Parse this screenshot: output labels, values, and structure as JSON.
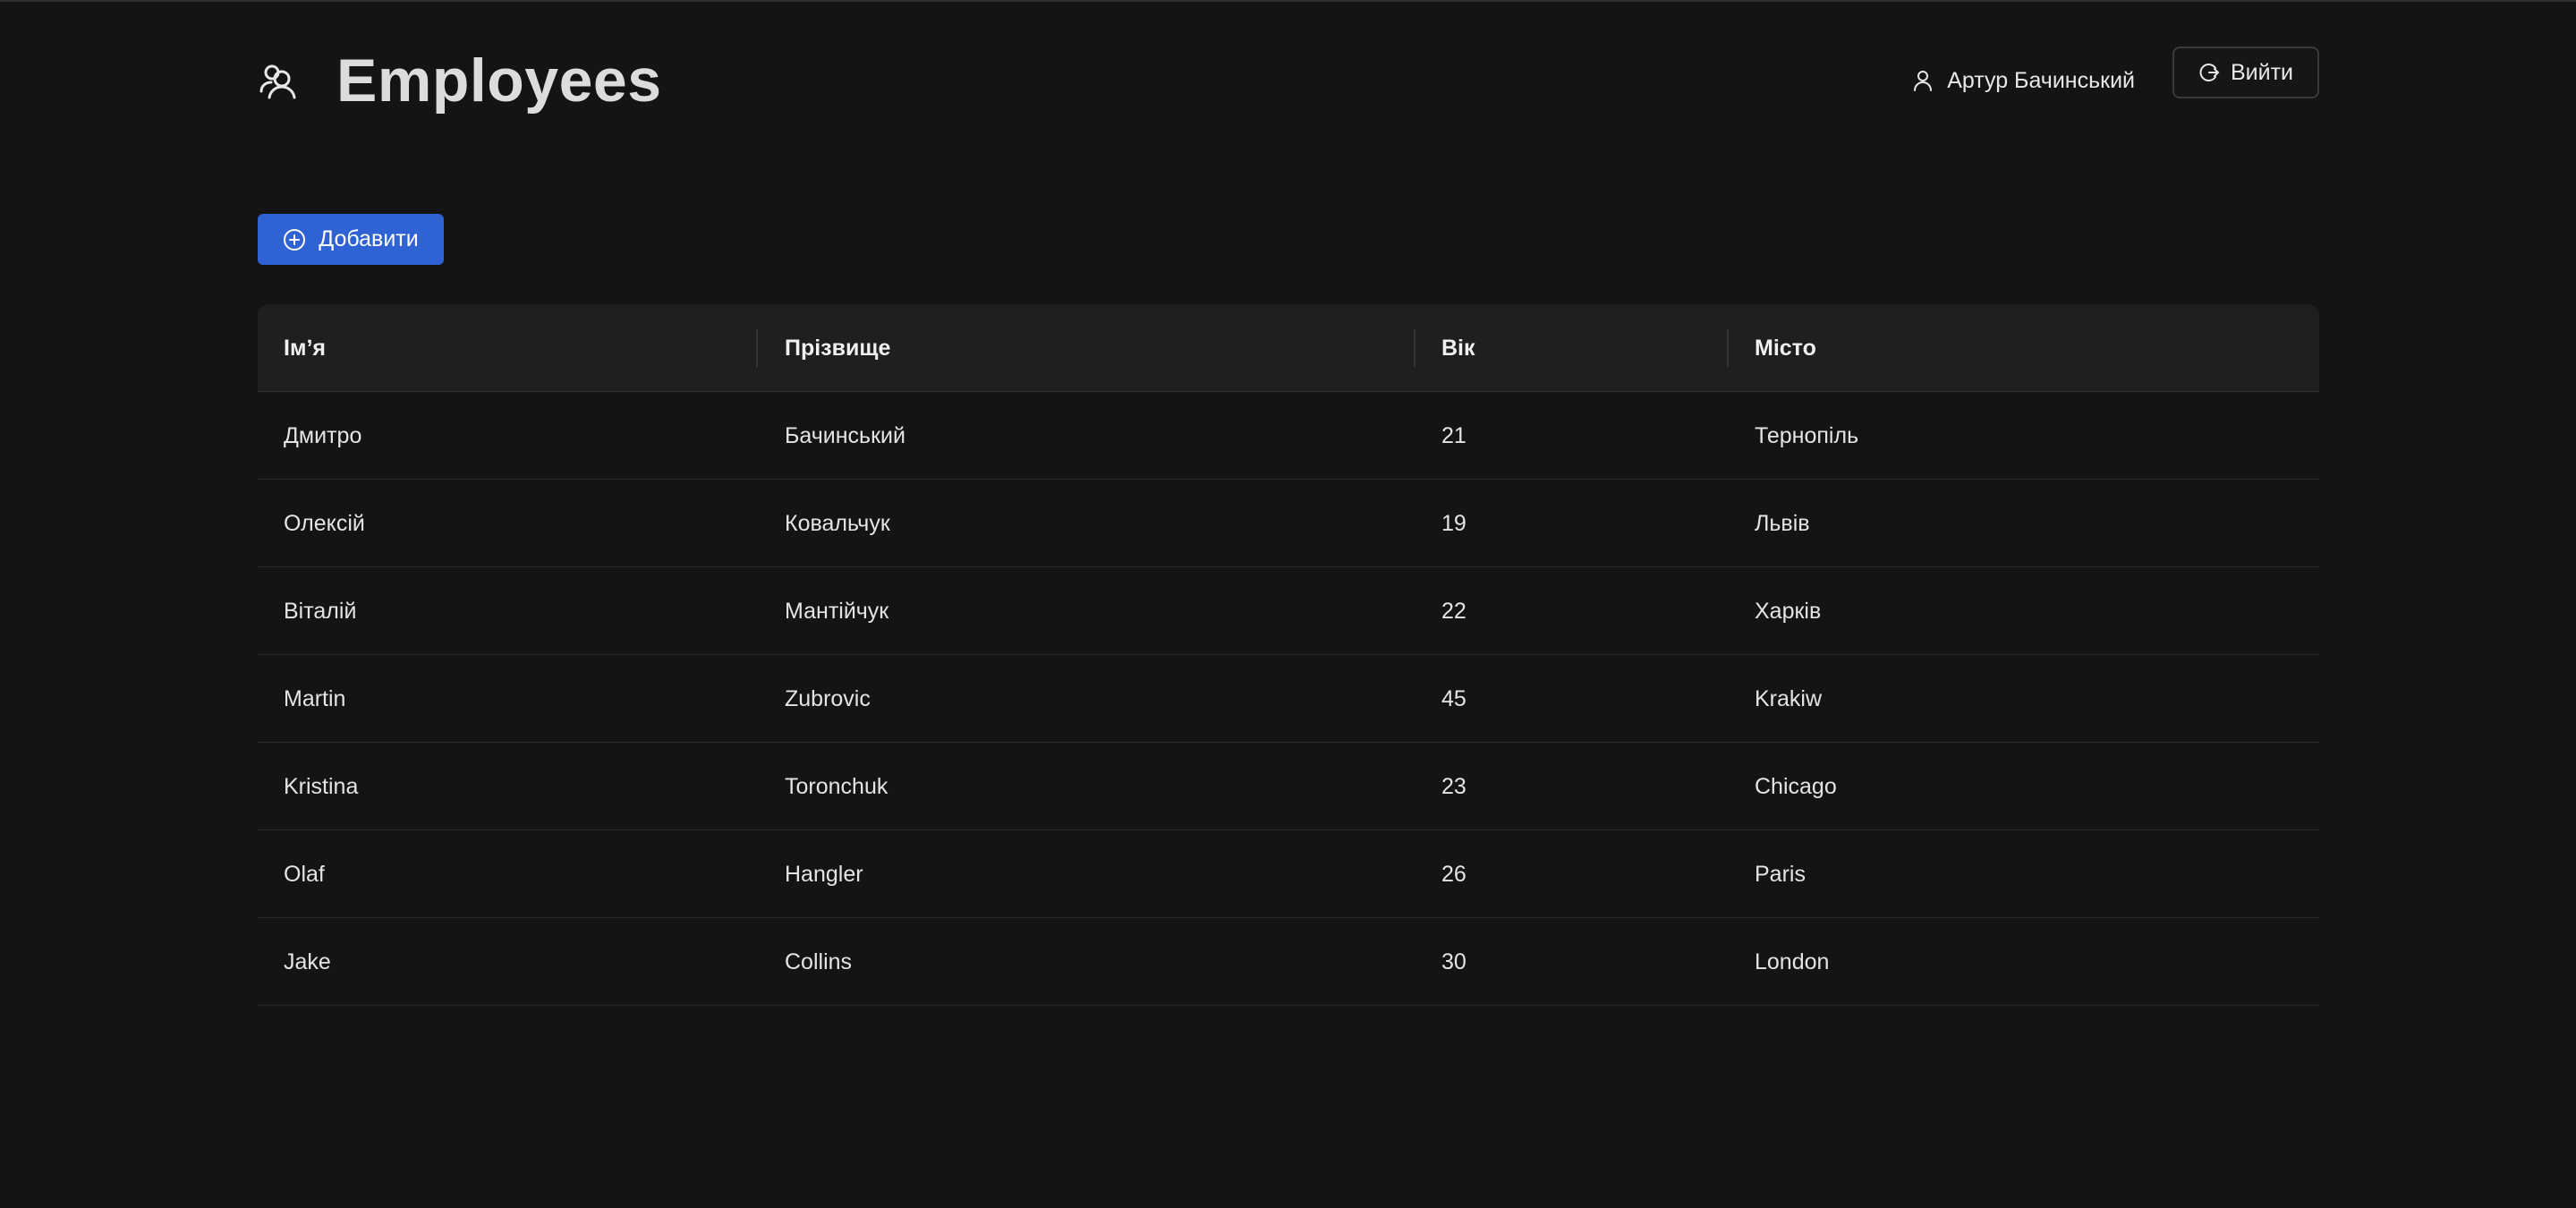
{
  "header": {
    "title": "Employees",
    "logo_icon": "users-icon",
    "user_name": "Артур Бачинський",
    "user_icon": "user-icon",
    "logout_label": "Вийти",
    "logout_icon": "logout-icon"
  },
  "toolbar": {
    "add_label": "Добавити",
    "add_icon": "plus-circle-icon"
  },
  "table": {
    "columns": [
      "Імʼя",
      "Прізвище",
      "Вік",
      "Місто"
    ],
    "rows": [
      [
        "Дмитро",
        "Бачинський",
        "21",
        "Тернопіль"
      ],
      [
        "Олексій",
        "Ковальчук",
        "19",
        "Львів"
      ],
      [
        "Віталій",
        "Мантійчук",
        "22",
        "Харків"
      ],
      [
        "Martin",
        "Zubrovic",
        "45",
        "Krakiw"
      ],
      [
        "Kristina",
        "Toronchuk",
        "23",
        "Chicago"
      ],
      [
        "Olaf",
        "Hangler",
        "26",
        "Paris"
      ],
      [
        "Jake",
        "Collins",
        "30",
        "London"
      ]
    ]
  },
  "colors": {
    "background": "#141414",
    "accent": "#2f62d2",
    "header_row": "#1f1f1f"
  }
}
